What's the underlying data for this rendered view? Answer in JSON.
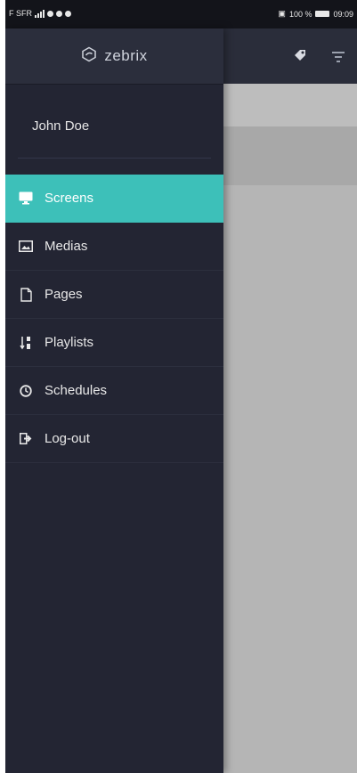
{
  "status_bar": {
    "carrier": "F SFR",
    "battery_text": "100 %",
    "time": "09:09"
  },
  "app": {
    "brand": "zebrix",
    "toolbar_icons": [
      "tag-icon",
      "filter-icon"
    ]
  },
  "drawer": {
    "user_name": "John Doe",
    "items": [
      {
        "label": "Screens",
        "icon": "monitor-icon",
        "active": true
      },
      {
        "label": "Medias",
        "icon": "image-icon",
        "active": false
      },
      {
        "label": "Pages",
        "icon": "file-icon",
        "active": false
      },
      {
        "label": "Playlists",
        "icon": "sort-icon",
        "active": false
      },
      {
        "label": "Schedules",
        "icon": "clock-icon",
        "active": false
      },
      {
        "label": "Log-out",
        "icon": "logout-icon",
        "active": false
      }
    ]
  },
  "colors": {
    "accent": "#3dc0b9",
    "drawer_bg": "#232533",
    "header_bg": "#2b2e3c"
  }
}
